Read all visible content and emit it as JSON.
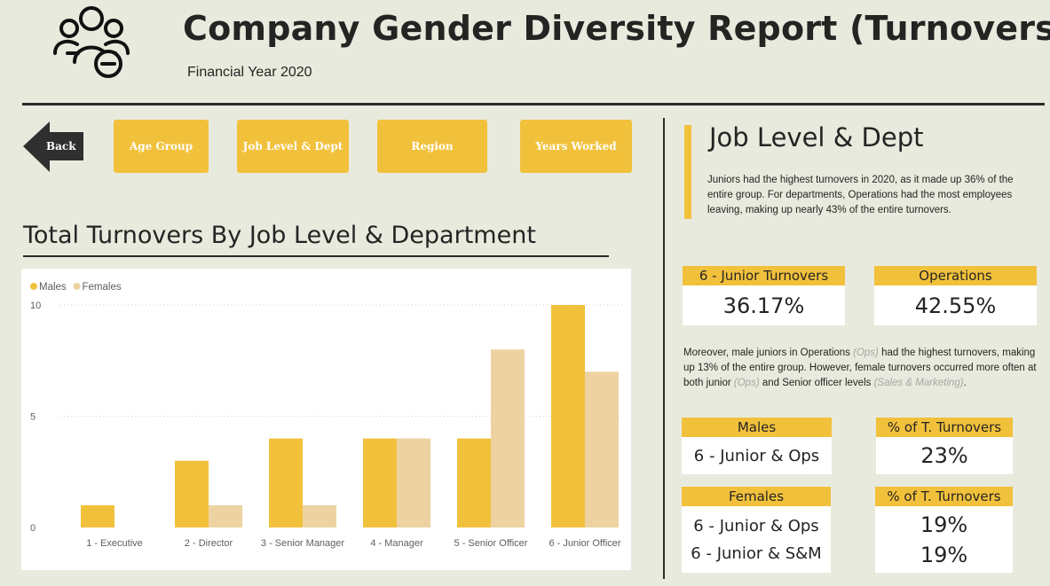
{
  "header": {
    "title": "Company Gender Diversity Report (Turnovers)",
    "subtitle": "Financial Year 2020",
    "logo_icon": "people-minus-icon"
  },
  "nav": {
    "back_label": "Back",
    "buttons": [
      "Age Group",
      "Job Level & Dept",
      "Region",
      "Years Worked"
    ]
  },
  "chart_section": {
    "title": "Total Turnovers By Job Level & Department"
  },
  "chart_data": {
    "type": "bar",
    "categories": [
      "1 - Executive",
      "2 - Director",
      "3 - Senior Manager",
      "4 - Manager",
      "5 - Senior Officer",
      "6 - Junior Officer"
    ],
    "series": [
      {
        "name": "Males",
        "values": [
          1,
          3,
          4,
          4,
          4,
          10
        ],
        "color": "#f2c13c"
      },
      {
        "name": "Females",
        "values": [
          0,
          1,
          1,
          4,
          8,
          7
        ],
        "color": "#edd3a2"
      }
    ],
    "yticks": [
      0,
      5,
      10
    ],
    "ylim": [
      0,
      10
    ],
    "grid": true,
    "legend": "top-left"
  },
  "side": {
    "title": "Job Level & Dept",
    "intro": "Juniors had the highest turnovers in 2020, as it made up 36% of the entire group. For departments, Operations had the most employees leaving, making up nearly 43% of the entire turnovers.",
    "kpi1": {
      "label": "6 - Junior Turnovers",
      "value": "36.17%"
    },
    "kpi2": {
      "label": "Operations",
      "value": "42.55%"
    },
    "para2": {
      "t1": "Moreover, male juniors in Operations ",
      "m1": "(Ops)",
      "t2": " had the highest turnovers, making up 13% of the entire group. However, female turnovers occurred more often at both junior ",
      "m2": "(Ops)",
      "t3": " and Senior officer levels ",
      "m3": "(Sales & Marketing)",
      "t4": "."
    },
    "males": {
      "label": "Males",
      "value": "6 - Junior & Ops"
    },
    "males_pct": {
      "label": "% of T. Turnovers",
      "value": "23%"
    },
    "females": {
      "label": "Females",
      "values": [
        "6 - Junior & Ops",
        "6 - Junior & S&M"
      ]
    },
    "females_pct": {
      "label": "% of T. Turnovers",
      "values": [
        "19%",
        "19%"
      ]
    }
  }
}
